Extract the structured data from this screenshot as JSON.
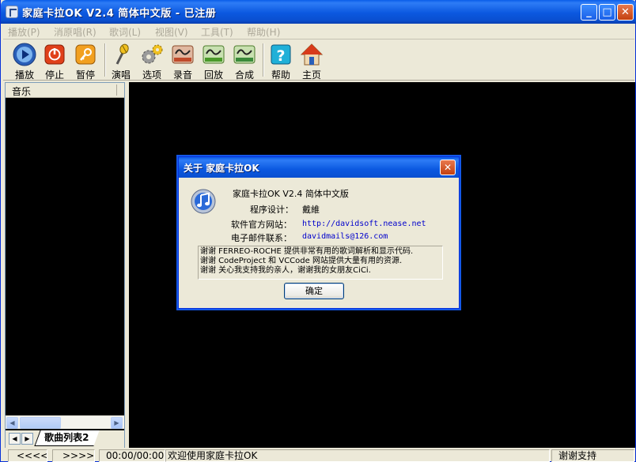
{
  "window": {
    "title": "家庭卡拉OK V2.4 简体中文版 - 已注册",
    "min_label": "_",
    "max_label": "□",
    "close_label": "✕"
  },
  "menu": [
    "播放(P)",
    "消原唱(R)",
    "歌词(L)",
    "视图(V)",
    "工具(T)",
    "帮助(H)"
  ],
  "toolbar": {
    "play": "播放",
    "stop": "停止",
    "pause": "暂停",
    "sing": "演唱",
    "options": "选项",
    "record": "录音",
    "playback": "回放",
    "mix": "合成",
    "help": "帮助",
    "home": "主页"
  },
  "playlist": {
    "column_header": "音乐",
    "tab_label": "歌曲列表2"
  },
  "status": {
    "prev": "<<<<",
    "next": ">>>>",
    "time": "00:00/00:00",
    "message": "欢迎使用家庭卡拉OK",
    "thanks": "谢谢支持"
  },
  "about": {
    "title": "关于 家庭卡拉OK",
    "product": "家庭卡拉OK V2.4 简体中文版",
    "designer_label": "程序设计：",
    "designer": "戴維",
    "site_label": "软件官方网站：",
    "site": "http://davidsoft.nease.net",
    "email_label": "电子邮件联系：",
    "email": "davidmails@126.com",
    "thanks_lines": [
      "谢谢 FERREO-ROCHE 提供非常有用的歌词解析和显示代码.",
      "谢谢 CodeProject 和 VCCode 网站提供大量有用的资源.",
      "谢谢 关心我支持我的亲人，谢谢我的女朋友CiCi."
    ],
    "ok_label": "确定"
  },
  "colors": {
    "titlebar": "#0a5de8",
    "dialog_border": "#0831d9",
    "link": "#0000cc",
    "menu_disabled": "#aca899",
    "panel_bg": "#000000"
  },
  "icons": {
    "play": "play-circle-icon",
    "stop": "stop-power-icon",
    "pause": "key-pause-icon",
    "sing": "microphone-icon",
    "options": "gears-icon",
    "record": "sound-record-icon",
    "playback": "sound-playback-icon",
    "mix": "sound-mix-icon",
    "help": "help-question-icon",
    "home": "home-house-icon",
    "about": "music-note-icon"
  }
}
